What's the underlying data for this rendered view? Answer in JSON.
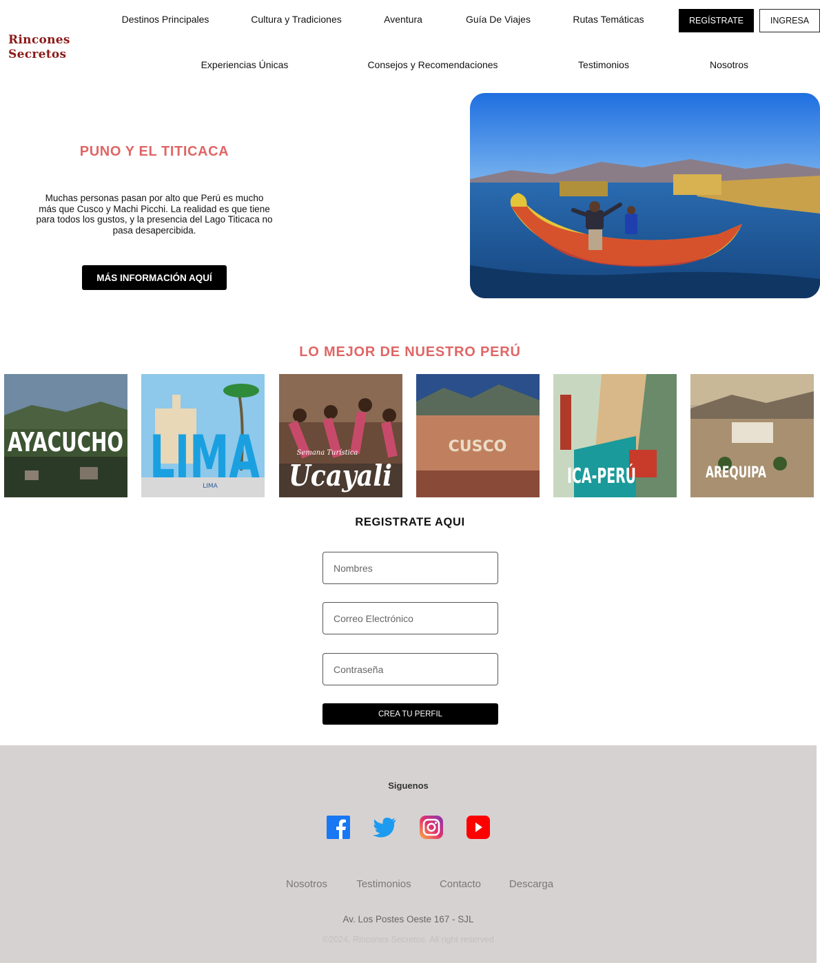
{
  "brand": {
    "line1": "Rincones",
    "line2": "Secretos",
    "color": "#8b1a1a"
  },
  "nav": {
    "row1": [
      "Destinos Principales",
      "Cultura y Tradiciones",
      "Aventura",
      "Guía De Viajes",
      "Rutas Temáticas"
    ],
    "row2": [
      "Experiencias Únicas",
      "Consejos y Recomendaciones",
      "Testimonios",
      "Nosotros"
    ],
    "register_label": "REGÍSTRATE",
    "login_label": "INGRESA"
  },
  "hero": {
    "title": "PUNO Y EL TITICACA",
    "text": "Muchas personas pasan por alto que Perú es mucho más que Cusco y Machi Picchi. La realidad es que tiene para todos los gustos, y la presencia del Lago Titicaca no pasa desapercibida.",
    "button_label": "MÁS INFORMACIÓN AQUÍ",
    "accent": "#e06565"
  },
  "destinations": {
    "title": "LO MEJOR DE NUESTRO PERÚ",
    "items": [
      {
        "label": "AYACUCHO"
      },
      {
        "label": "LIMA",
        "sublabel": "LIMA"
      },
      {
        "label": "Ucayali",
        "sublabel": "Semana Turística"
      },
      {
        "label": "CUSCO"
      },
      {
        "label": "ICA-PERÚ"
      },
      {
        "label": "AREQUIPA"
      }
    ]
  },
  "register": {
    "title": "REGISTRATE AQUI",
    "name_placeholder": "Nombres",
    "email_placeholder": "Correo Electrónico",
    "password_placeholder": "Contraseña",
    "submit_label": "CREA TU PERFIL"
  },
  "footer": {
    "follow_label": "Siguenos",
    "social": [
      "facebook-icon",
      "twitter-icon",
      "instagram-icon",
      "youtube-icon"
    ],
    "links": [
      "Nosotros",
      "Testimonios",
      "Contacto",
      "Descarga"
    ],
    "address": "Av. Los Postes Oeste 167 - SJL",
    "copyright": "©2024, Rincones Secretos. All right reserved",
    "background": "#d7d2d2"
  }
}
